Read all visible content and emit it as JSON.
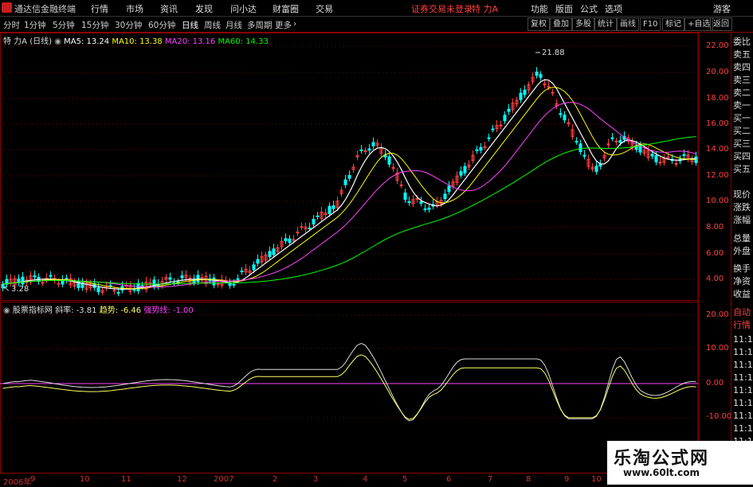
{
  "titlebar": {
    "app_name": "通达信金融终端",
    "menus": [
      "行情",
      "市场",
      "资讯",
      "发现",
      "问小达",
      "财富圈",
      "交易"
    ],
    "notice": "证券交易未登录",
    "stock_title": "特 力A",
    "right_menus": [
      "功能",
      "版面",
      "公式",
      "选项"
    ],
    "user": "游客"
  },
  "toolbar": {
    "periods": [
      "分时",
      "1分钟",
      "5分钟",
      "15分钟",
      "30分钟",
      "60分钟",
      "日线",
      "周线",
      "月线",
      "多周期",
      "更多"
    ],
    "active_period": "日线",
    "buttons": [
      "复权",
      "叠加",
      "多股",
      "统计",
      "画线",
      "F10",
      "标记",
      "+自选",
      "返回"
    ]
  },
  "main_legend": {
    "name": "特 力A (日线)",
    "ma5": "MA5: 13.24",
    "ma10": "MA10: 13.38",
    "ma20": "MA20: 13.16",
    "ma60": "MA60: 14.33",
    "ma5_color": "#ffffff",
    "ma10_color": "#ffff00",
    "ma20_color": "#ff44ff",
    "ma60_color": "#00ff00"
  },
  "price_annotations": {
    "high": "21.88",
    "low": "3.28"
  },
  "price_axis": [
    "22.00",
    "20.00",
    "18.00",
    "16.00",
    "14.00",
    "12.00",
    "10.00",
    "8.00",
    "6.00",
    "4.00"
  ],
  "indicator_legend": {
    "name": "股票指标网",
    "slope": "斜率: -3.81",
    "trend": "趋势: -6.46",
    "strength": "强势线: -1.00",
    "slope_color": "#dddddd",
    "trend_color": "#ffff66",
    "strength_color": "#ff44ff"
  },
  "indicator_axis": [
    "20.00",
    "10.00",
    "0.00",
    "-10.00"
  ],
  "x_axis": [
    "2006年",
    "9",
    "10",
    "11",
    "12",
    "2007",
    "2",
    "3",
    "4",
    "5",
    "6",
    "7",
    "8",
    "9",
    "10"
  ],
  "right_panel": [
    "委比",
    "卖五",
    "卖四",
    "卖三",
    "卖二",
    "卖一",
    "买一",
    "买二",
    "买三",
    "买四",
    "买五",
    "现价",
    "涨跌",
    "涨幅",
    "总量",
    "外盘",
    "换手",
    "净资",
    "收益",
    "自动",
    "行情",
    "11:1",
    "11:1",
    "11:1",
    "11:1",
    "11:1",
    "11:1",
    "11:1",
    "11:1",
    "11:1"
  ],
  "watermark": {
    "title": "乐淘公式网",
    "url": "www.60lt.com"
  }
}
